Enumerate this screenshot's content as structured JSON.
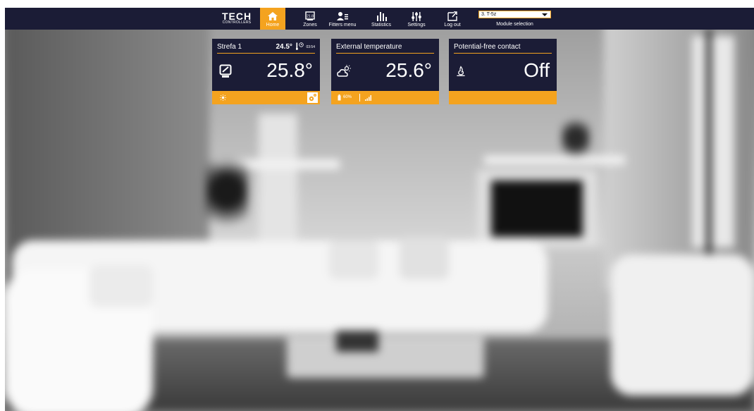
{
  "nav": {
    "logo_main": "TECH",
    "logo_sub": "CONTROLLERS",
    "items": [
      {
        "label": "Home",
        "icon": "home-icon",
        "active": true
      },
      {
        "label": "Zones",
        "icon": "zones-icon",
        "active": false
      },
      {
        "label": "Fitters menu",
        "icon": "fitters-icon",
        "active": false
      },
      {
        "label": "Statistics",
        "icon": "statistics-icon",
        "active": false
      },
      {
        "label": "Settings",
        "icon": "settings-icon",
        "active": false
      },
      {
        "label": "Log out",
        "icon": "logout-icon",
        "active": false
      }
    ],
    "zones_icon_text": "21.8",
    "module_select": {
      "value": "3. T-5z",
      "label": "Module selection"
    }
  },
  "tiles": {
    "zone": {
      "name": "Strefa 1",
      "set_temp": "24.5°",
      "time": "03:54",
      "current_temp": "25.8°",
      "mode_icon": "sun-icon",
      "settings_icon": "gear-icon"
    },
    "external": {
      "title": "External temperature",
      "value": "25.6°",
      "battery": "60%",
      "icon": "weather-icon",
      "signal_icon": "signal-icon"
    },
    "contact": {
      "title": "Potential-free contact",
      "value": "Off",
      "icon": "flame-icon"
    }
  },
  "colors": {
    "navbar": "#1b1c36",
    "accent": "#f4a31f",
    "text": "#ffffff"
  }
}
